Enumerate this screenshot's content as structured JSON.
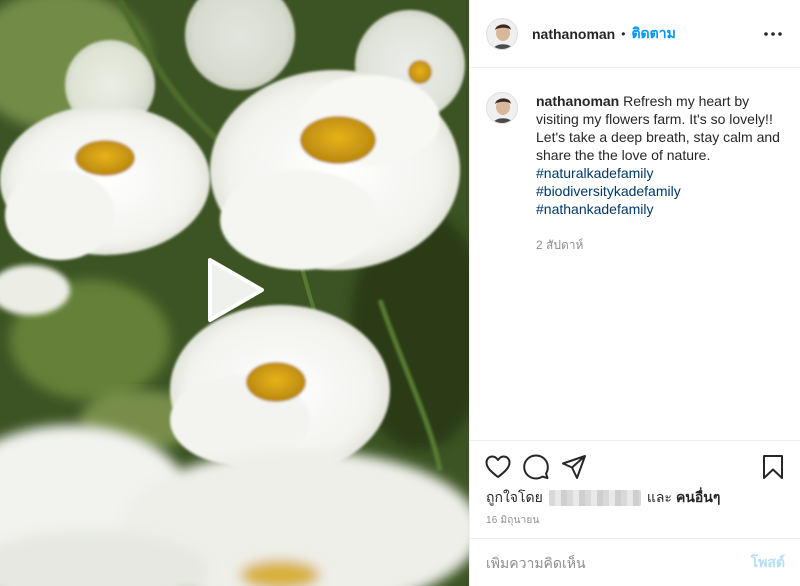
{
  "post": {
    "username": "nathanoman",
    "follow_label": "ติดตาม",
    "header_separator": "•",
    "media": {
      "type": "video",
      "play_icon": "play-icon"
    },
    "caption": {
      "username": "nathanoman",
      "text": "Refresh my heart by visiting my flowers farm. It's so lovely!! Let's take a deep breath, stay calm and share the the love of nature.",
      "hashtags": [
        "#naturalkadefamily",
        "#biodiversitykadefamily",
        "#nathankadefamily"
      ],
      "time_ago": "2 สัปดาห์"
    },
    "actions": {
      "like_icon": "heart-icon",
      "comment_icon": "comment-icon",
      "share_icon": "share-icon",
      "save_icon": "bookmark-icon",
      "more_icon": "more-options-icon"
    },
    "likes": {
      "prefix": "ถูกใจโดย",
      "middle": "และ",
      "others": "คนอื่นๆ"
    },
    "date": "16 มิถุนายน",
    "comment": {
      "placeholder": "เพิ่มความคิดเห็น",
      "post_label": "โพสต์"
    }
  },
  "colors": {
    "link_blue": "#0095f6",
    "hashtag": "#00376b",
    "muted": "#8e8e8e",
    "post_disabled": "#b2dffc"
  }
}
